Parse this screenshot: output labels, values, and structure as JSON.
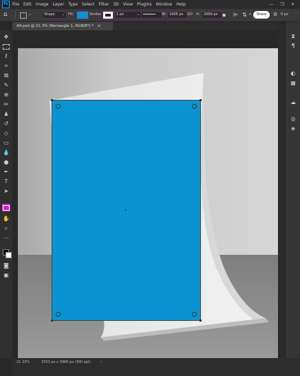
{
  "app": {
    "logo": "Ps"
  },
  "menu": [
    "File",
    "Edit",
    "Image",
    "Layer",
    "Type",
    "Select",
    "Filter",
    "3D",
    "View",
    "Plugins",
    "Window",
    "Help"
  ],
  "window_controls": {
    "minimize": "—",
    "maximize": "❐",
    "close": "✕"
  },
  "options": {
    "mode": "Shape",
    "fill_label": "Fill:",
    "fill_color": "#0a94d3",
    "stroke_label": "Stroke:",
    "stroke_width": "1 px",
    "width_label": "W:",
    "width_value": "1905 px",
    "link_label": "GO",
    "height_label": "H:",
    "height_value": "2669 px",
    "share": "Share",
    "zoom_readout": "0 px"
  },
  "document_tab": {
    "title": "A4.psd @ 21.3% (Rectangle 1, RGB/8*) *",
    "close": "×"
  },
  "status": {
    "zoom": "21.33%",
    "dimensions": "3333 px x 3966 px (300 ppi)",
    "arrow": "›"
  },
  "shape": {
    "color": "#0a94d3"
  },
  "icons": [
    "move-icon",
    "marquee-icon",
    "lasso-icon",
    "crop-icon",
    "frame-icon",
    "eyedropper-icon",
    "healing-icon",
    "brush-icon",
    "stamp-icon",
    "history-brush-icon",
    "eraser-icon",
    "gradient-icon",
    "blur-icon",
    "dodge-icon",
    "pen-icon",
    "type-icon",
    "path-select-icon",
    "rectangle-icon",
    "hand-icon",
    "zoom-icon",
    "more-icon"
  ]
}
